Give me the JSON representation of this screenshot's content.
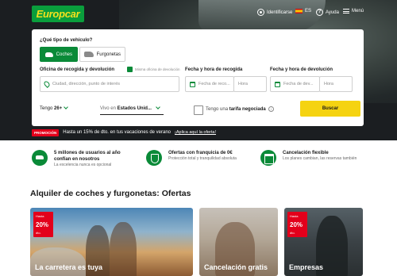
{
  "header": {
    "logo": "Europcar",
    "login_label": "Identificarse",
    "language": "ES",
    "help_label": "Ayuda",
    "menu_label": "Menú"
  },
  "booking": {
    "vehicle_type_question": "¿Qué tipo de vehículo?",
    "vehicle_types": [
      {
        "label": "Coches",
        "selected": true
      },
      {
        "label": "Furgonetas",
        "selected": false
      }
    ],
    "pickup_label": "Oficina de recogida y devolución",
    "same_office_label": "Misma oficina de devolución",
    "pickup_placeholder": "Ciudad, dirección, punto de interés",
    "pickup_datetime_label": "Fecha y hora de recogida",
    "pickup_date_placeholder": "Fecha de reco...",
    "pickup_time_placeholder": "Hora",
    "return_datetime_label": "Fecha y hora de devolución",
    "return_date_placeholder": "Fecha de dev...",
    "return_time_placeholder": "Hora",
    "age_prefix": "Tengo",
    "age_value": "26+",
    "residence_prefix": "Vivo en",
    "residence_value": "Estados Unid...",
    "negotiated_prefix": "Tengo una",
    "negotiated_bold": "tarifa negociada",
    "search_label": "Buscar"
  },
  "promo": {
    "tag": "PROMOCIÓN",
    "text": "Hasta un 15% de dto. en tus vacaciones de verano",
    "link": "¡Aplica aquí la oferta!"
  },
  "benefits": [
    {
      "icon": "car-icon",
      "title": "5 millones de usuarios al año confían en nosotros",
      "subtitle": "La excelencia nunca es opcional"
    },
    {
      "icon": "shield-check-icon",
      "title": "Ofertas con franquicia de 0€",
      "subtitle": "Protección total y tranquilidad absoluta"
    },
    {
      "icon": "calendar-icon",
      "title": "Cancelación flexible",
      "subtitle": "Los planes cambian, las reservas también"
    }
  ],
  "offers_title": "Alquiler de coches y furgonetas: Ofertas",
  "offers": [
    {
      "badge_top": "Hasta",
      "badge_pct": "20%",
      "badge_bottom": "dto.",
      "title": "La carretera es tuya"
    },
    {
      "title": "Cancelación gratis"
    },
    {
      "badge_top": "Hasta",
      "badge_pct": "20%",
      "badge_bottom": "dto.",
      "title": "Empresas"
    }
  ],
  "colors": {
    "brand_green": "#0a8a38",
    "logo_yellow": "#f5e11d",
    "cta_yellow": "#f5d311",
    "promo_red": "#e3001b",
    "hero_dark": "#1b1e21"
  }
}
